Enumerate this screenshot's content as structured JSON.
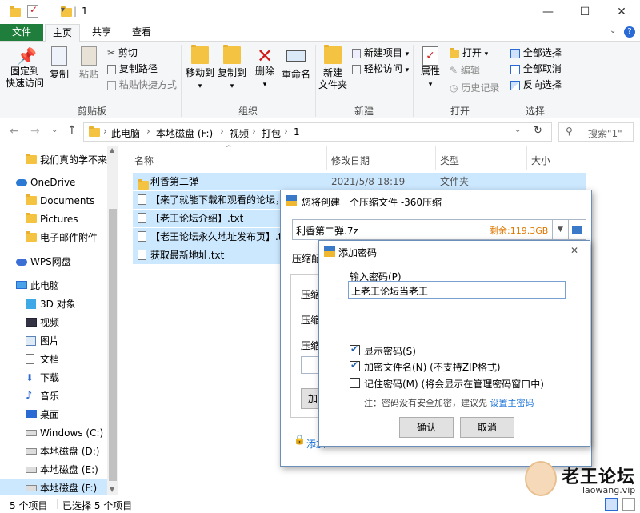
{
  "window": {
    "title": "1",
    "quick_access_divider": "|",
    "minimize": "—",
    "maximize": "☐",
    "close": "✕"
  },
  "ribbon": {
    "tabs": [
      "文件",
      "主页",
      "共享",
      "查看"
    ],
    "clipboard": {
      "pin_label_1": "固定到",
      "pin_label_2": "快速访问",
      "copy": "复制",
      "paste": "粘贴",
      "cut": "剪切",
      "copy_path": "复制路径",
      "paste_shortcut": "粘贴快捷方式",
      "group": "剪贴板"
    },
    "organize": {
      "move_to": "移动到",
      "copy_to": "复制到",
      "delete": "删除",
      "rename": "重命名",
      "group": "组织"
    },
    "new": {
      "new_folder_1": "新建",
      "new_folder_2": "文件夹",
      "new_item": "新建项目",
      "easy_access": "轻松访问",
      "group": "新建"
    },
    "open": {
      "properties": "属性",
      "open": "打开",
      "edit": "编辑",
      "history": "历史记录",
      "group": "打开"
    },
    "select": {
      "select_all": "全部选择",
      "select_none": "全部取消",
      "invert": "反向选择",
      "group": "选择"
    }
  },
  "address": {
    "crumbs": [
      "此电脑",
      "本地磁盘 (F:)",
      "视频",
      "打包",
      "1"
    ],
    "search_placeholder": "搜索\"1\""
  },
  "sidebar": {
    "items": [
      {
        "label": "我们真的学不来",
        "icon": "folder-icon"
      },
      {
        "label": "OneDrive",
        "icon": "cloud-icon"
      },
      {
        "label": "Documents",
        "icon": "folder-icon"
      },
      {
        "label": "Pictures",
        "icon": "folder-icon"
      },
      {
        "label": "电子邮件附件",
        "icon": "folder-icon"
      },
      {
        "label": "WPS网盘",
        "icon": "cloud-icon"
      },
      {
        "label": "此电脑",
        "icon": "computer-icon"
      },
      {
        "label": "3D 对象",
        "icon": "cube-icon"
      },
      {
        "label": "视频",
        "icon": "video-icon"
      },
      {
        "label": "图片",
        "icon": "picture-icon"
      },
      {
        "label": "文档",
        "icon": "document-icon"
      },
      {
        "label": "下载",
        "icon": "download-icon"
      },
      {
        "label": "音乐",
        "icon": "music-icon"
      },
      {
        "label": "桌面",
        "icon": "desktop-icon"
      },
      {
        "label": "Windows (C:)",
        "icon": "drive-icon"
      },
      {
        "label": "本地磁盘 (D:)",
        "icon": "drive-icon"
      },
      {
        "label": "本地磁盘 (E:)",
        "icon": "drive-icon"
      },
      {
        "label": "本地磁盘 (F:)",
        "icon": "drive-icon"
      }
    ]
  },
  "file_list": {
    "columns": [
      "名称",
      "修改日期",
      "类型",
      "大小"
    ],
    "rows": [
      {
        "name": "利香第二弹",
        "date": "2021/5/8 18:19",
        "type": "文件夹",
        "kind": "folder"
      },
      {
        "name": "【来了就能下载和观看的论坛，轻",
        "date": "",
        "type": "",
        "kind": "doc"
      },
      {
        "name": "【老王论坛介绍】.txt",
        "date": "",
        "type": "",
        "kind": "doc"
      },
      {
        "name": "【老王论坛永久地址发布页】.tx",
        "date": "",
        "type": "",
        "kind": "doc"
      },
      {
        "name": "获取最新地址.txt",
        "date": "",
        "type": "",
        "kind": "doc"
      }
    ]
  },
  "status": {
    "count": "5 个项目",
    "selected": "已选择 5 个项目"
  },
  "compress_dialog": {
    "title": "您将创建一个压缩文件 -360压缩",
    "filename": "利香第二弹.7z",
    "free_space": "剩余:119.3GB",
    "config_label": "压缩配",
    "row1": "压缩格",
    "row2": "压缩方",
    "row3": "压缩分",
    "add_btn": "加",
    "add_password_link": "添加"
  },
  "password_dialog": {
    "title": "添加密码",
    "input_label": "输入密码(P)",
    "password_value": "上老王论坛当老王",
    "show_password": "显示密码(S)",
    "encrypt_names": "加密文件名(N) (不支持ZIP格式)",
    "remember": "记住密码(M) (将会显示在管理密码窗口中)",
    "note_prefix": "注：密码没有安全加密，建议先 ",
    "note_link": "设置主密码",
    "ok": "确认",
    "cancel": "取消",
    "close": "✕"
  },
  "watermark": {
    "brand": "老王论坛",
    "url": "laowang.vip"
  },
  "colors": {
    "file_tab_green": "#1f7e3b",
    "selection_blue": "#cce8ff",
    "link_blue": "#1a73d9",
    "free_space_orange": "#e07800"
  }
}
